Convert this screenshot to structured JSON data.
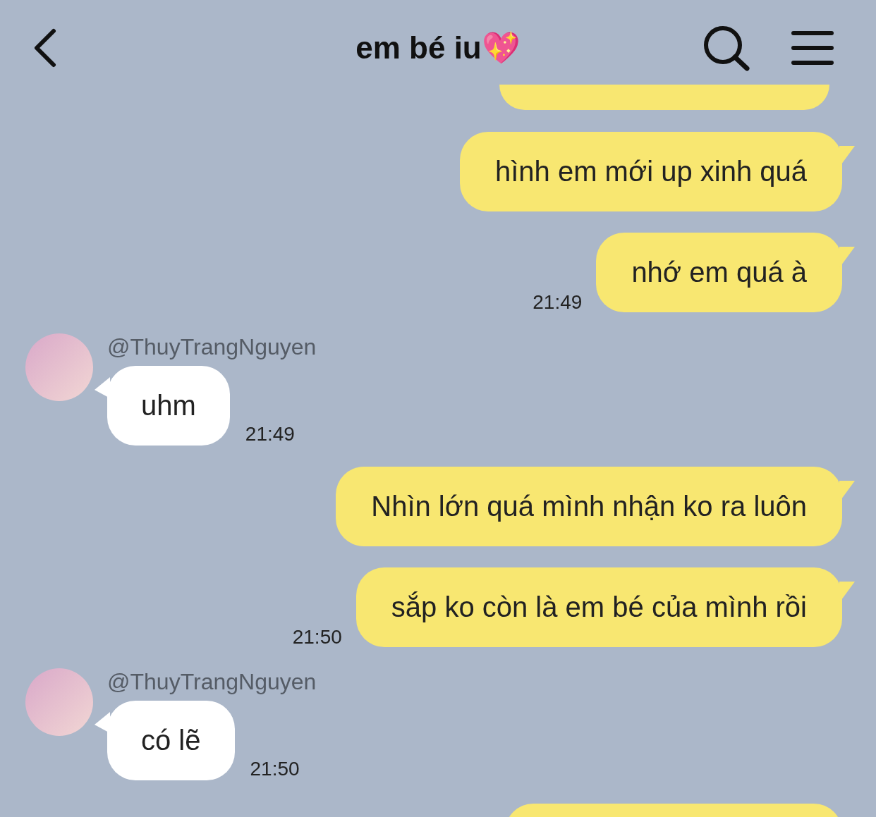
{
  "header": {
    "title": "em bé iu💖"
  },
  "messages": [
    {
      "kind": "sent",
      "text": "hình em mới up xinh quá"
    },
    {
      "kind": "sent",
      "text": "nhớ em quá à",
      "time": "21:49"
    },
    {
      "kind": "received",
      "sender": "@ThuyTrangNguyen",
      "text": "uhm",
      "time": "21:49"
    },
    {
      "kind": "sent",
      "text": "Nhìn lớn quá mình nhận ko ra luôn"
    },
    {
      "kind": "sent",
      "text": "sắp ko còn là em bé của mình rồi",
      "time": "21:50"
    },
    {
      "kind": "received",
      "sender": "@ThuyTrangNguyen",
      "text": "có lẽ",
      "time": "21:50"
    }
  ]
}
